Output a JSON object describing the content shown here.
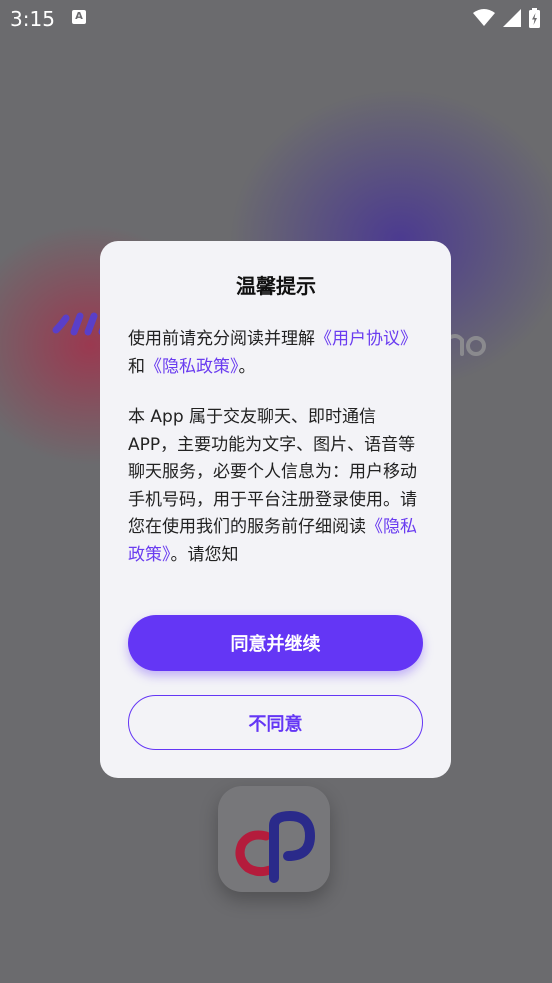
{
  "status_bar": {
    "time": "3:15",
    "notification_icon": "a-letter-notification-icon",
    "icons": [
      "wifi-icon",
      "signal-icon",
      "battery-charging-icon"
    ]
  },
  "dialog": {
    "title": "温馨提示",
    "para1": {
      "prefix": "使用前请充分阅读并理解",
      "link_user_agreement": "《用户协议》",
      "middle": "和",
      "link_privacy_policy": "《隐私政策》",
      "suffix": "。"
    },
    "para2": {
      "text_before_link": "本 App 属于交友聊天、即时通信APP，主要功能为文字、图片、语音等聊天服务，必要个人信息为：用户移动手机号码，用于平台注册登录使用。请您在使用我们的服务前仔细阅读",
      "link_privacy_policy": "《隐私政策》",
      "text_after_link": "。请您知"
    },
    "agree_button": "同意并继续",
    "disagree_button": "不同意"
  },
  "colors": {
    "accent": "#6436f5",
    "link": "#6a3cf0",
    "dialog_bg": "#f3f3f7",
    "overlay": "#6b6b6e"
  }
}
